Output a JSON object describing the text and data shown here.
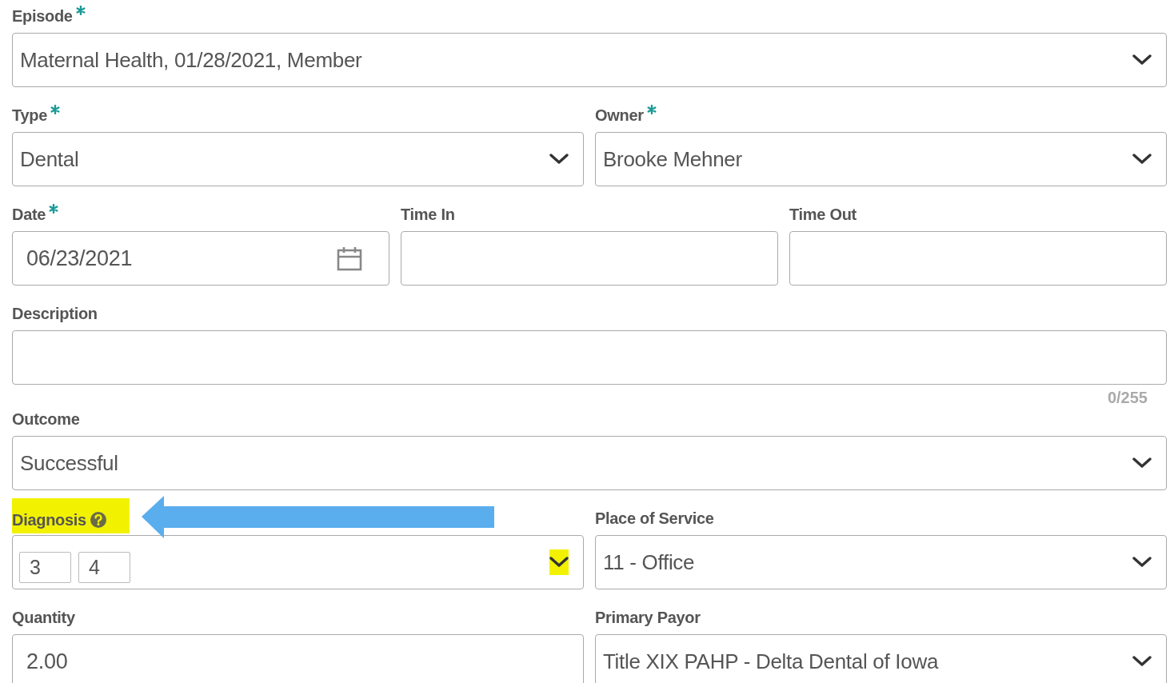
{
  "form": {
    "rows": [
      {
        "fields": [
          {
            "label": "Episode",
            "required": true,
            "kind": "select",
            "value": "Maternal Health, 01/28/2021, Member"
          }
        ]
      },
      {
        "fields": [
          {
            "label": "Type",
            "required": true,
            "kind": "select",
            "value": "Dental"
          },
          {
            "label": "Owner",
            "required": true,
            "kind": "select",
            "value": "Brooke Mehner"
          }
        ]
      },
      {
        "fields": [
          {
            "label": "Date",
            "required": true,
            "kind": "date",
            "value": "06/23/2021"
          },
          {
            "label": "Time In",
            "required": false,
            "kind": "text"
          },
          {
            "label": "Time Out",
            "required": false,
            "kind": "text"
          }
        ]
      },
      {
        "fields": [
          {
            "label": "Description",
            "required": false,
            "kind": "text",
            "counter": "0/255"
          }
        ]
      },
      {
        "fields": [
          {
            "label": "Outcome",
            "required": false,
            "kind": "select",
            "value": "Successful"
          }
        ]
      },
      {
        "fields": [
          {
            "label": "Diagnosis",
            "required": false,
            "kind": "tags",
            "tags": [
              "3",
              "4"
            ],
            "help": true,
            "highlighted": true,
            "caret_highlighted": true,
            "annotation": {
              "kind": "arrow"
            }
          },
          {
            "label": "Place of Service",
            "required": false,
            "kind": "select",
            "value": "11 - Office"
          }
        ]
      },
      {
        "fields": [
          {
            "label": "Quantity",
            "required": false,
            "kind": "text",
            "value": "2.00"
          },
          {
            "label": "Primary Payor",
            "required": false,
            "kind": "select",
            "value": "Title XIX PAHP - Delta Dental of Iowa"
          }
        ]
      }
    ]
  }
}
